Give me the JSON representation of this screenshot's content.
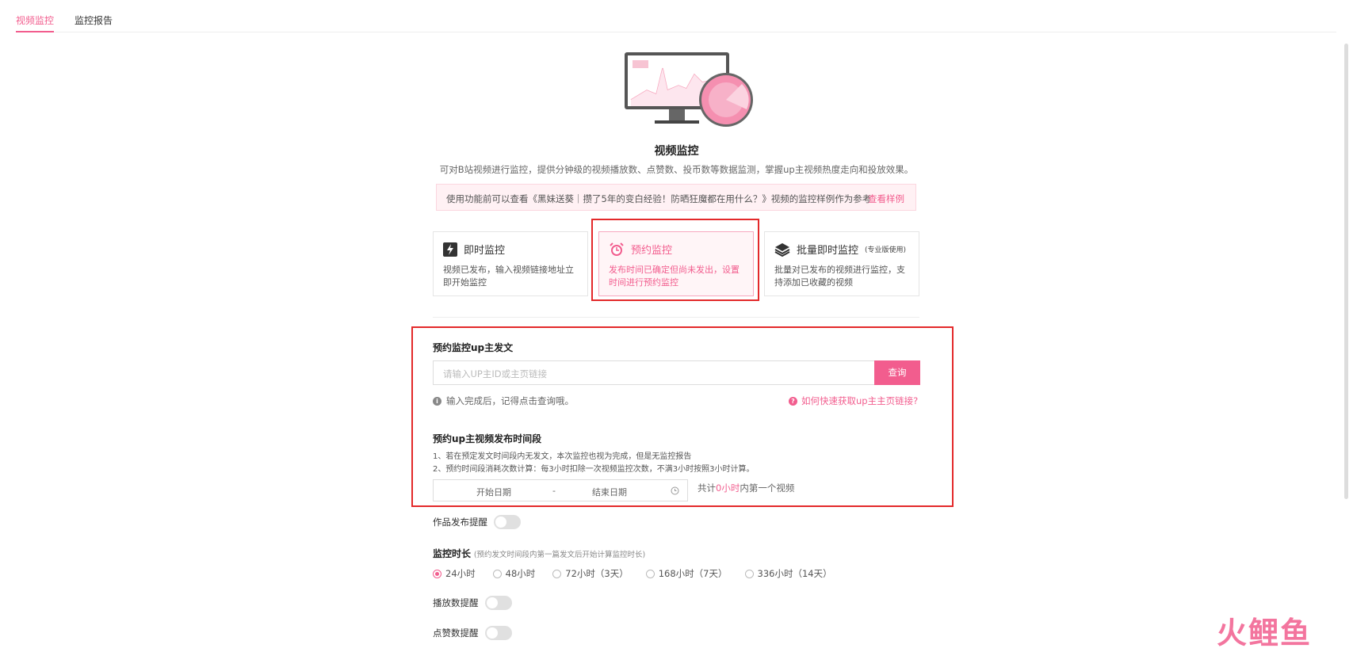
{
  "tabs": [
    {
      "label": "视频监控",
      "active": true
    },
    {
      "label": "监控报告",
      "active": false
    }
  ],
  "hero": {
    "title": "视频监控",
    "desc": "可对B站视频进行监控，提供分钟级的视频播放数、点赞数、投币数等数据监测，掌握up主视频热度走向和投放效果。"
  },
  "notice": {
    "text": "使用功能前可以查看《黑妹送葵｜攒了5年的变白经验！防晒狂魔都在用什么？》视频的监控样例作为参考",
    "link": "查看样例"
  },
  "modes": [
    {
      "title": "即时监控",
      "sub": "",
      "desc": "视频已发布，输入视频链接地址立即开始监控",
      "icon": "lightning-icon",
      "selected": false
    },
    {
      "title": "预约监控",
      "sub": "",
      "desc": "发布时间已确定但尚未发出，设置时间进行预约监控",
      "icon": "alarm-clock-icon",
      "selected": true
    },
    {
      "title": "批量即时监控",
      "sub": "(专业版使用)",
      "desc": "批量对已发布的视频进行监控，支持添加已收藏的视频",
      "icon": "layers-icon",
      "selected": false
    }
  ],
  "form": {
    "up_label": "预约监控up主发文",
    "placeholder": "请输入UP主ID或主页链接",
    "query_button": "查询",
    "hint": "输入完成后，记得点击查询哦。",
    "help_link": "如何快速获取up主主页链接?",
    "period_label": "预约up主视频发布时间段",
    "rule1": "1、若在预定发文时间段内无发文，本次监控也视为完成，但是无监控报告",
    "rule2": "2、预约时间段消耗次数计算：每3小时扣除一次视频监控次数，不满3小时按照3小时计算。",
    "start_date": "开始日期",
    "range_sep": "-",
    "end_date": "结束日期",
    "count_prefix": "共计",
    "count_value": "0小时",
    "count_suffix": "内第一个视频"
  },
  "publish_reminder": "作品发布提醒",
  "duration": {
    "label": "监控时长",
    "note": "(预约发文时间段内第一篇发文后开始计算监控时长)",
    "options": [
      "24小时",
      "48小时",
      "72小时（3天）",
      "168小时（7天）",
      "336小时（14天）"
    ],
    "selected": "24小时"
  },
  "play_reminder": "播放数提醒",
  "like_reminder": "点赞数提醒",
  "watermark": "火鲤鱼",
  "accent": "#f25d8e",
  "highlight": "#e3292a"
}
